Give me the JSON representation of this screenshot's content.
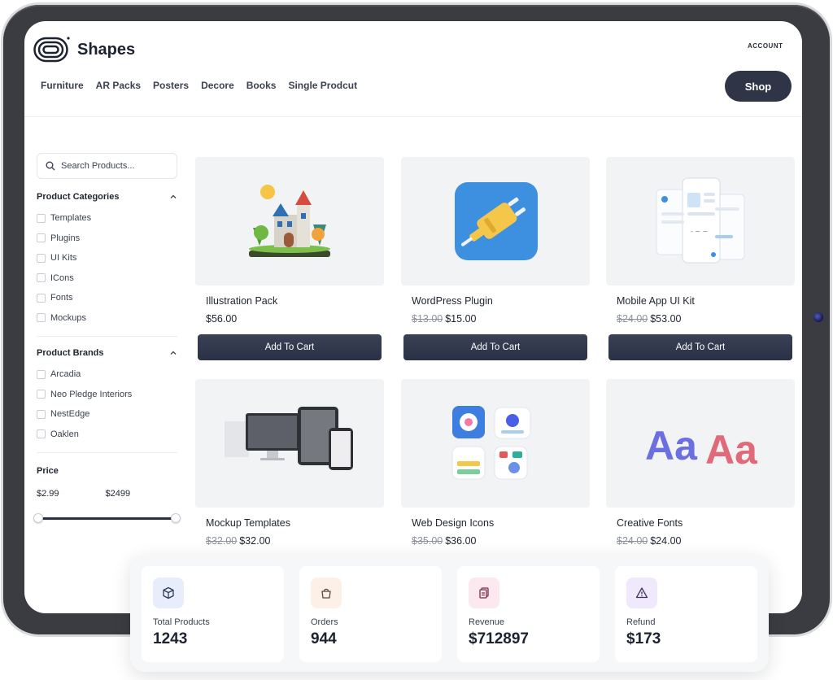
{
  "header": {
    "brand": "Shapes",
    "account_label": "ACCOUNT",
    "nav": [
      "Furniture",
      "AR Packs",
      "Posters",
      "Decore",
      "Books",
      "Single Prodcut"
    ],
    "shop_label": "Shop"
  },
  "sidebar": {
    "search_placeholder": "Search Products...",
    "categories_title": "Product Categories",
    "categories": [
      "Templates",
      "Plugins",
      "UI Kits",
      "ICons",
      "Fonts",
      "Mockups"
    ],
    "brands_title": "Product Brands",
    "brands": [
      "Arcadia",
      "Neo Pledge Interiors",
      "NestEdge",
      "Oaklen"
    ],
    "price_title": "Price",
    "price_min": "$2.99",
    "price_max": "$2499"
  },
  "products": [
    {
      "name": "Illustration Pack",
      "old_price": "",
      "price": "$56.00",
      "icon": "castle-illustration-icon"
    },
    {
      "name": "WordPress Plugin",
      "old_price": "$13.00",
      "price": "$15.00",
      "icon": "plug-icon"
    },
    {
      "name": "Mobile App UI Kit",
      "old_price": "$24.00",
      "price": "$53.00",
      "icon": "mobile-ui-icon"
    },
    {
      "name": "Mockup Templates",
      "old_price": "$32.00",
      "price": "$32.00",
      "icon": "devices-mockup-icon"
    },
    {
      "name": "Web Design Icons",
      "old_price": "$35.00",
      "price": "$36.00",
      "icon": "web-icons-icon"
    },
    {
      "name": "Creative Fonts",
      "old_price": "$24.00",
      "price": "$24.00",
      "icon": "font-aa-icon"
    }
  ],
  "cart_label": "Add To Cart",
  "stats": [
    {
      "label": "Total Products",
      "value": "1243",
      "icon": "box-icon",
      "color": "#e8edfb"
    },
    {
      "label": "Orders",
      "value": "944",
      "icon": "bag-icon",
      "color": "#fdf0e6"
    },
    {
      "label": "Revenue",
      "value": "$712897",
      "icon": "receipt-icon",
      "color": "#fce8ef"
    },
    {
      "label": "Refund",
      "value": "$173",
      "icon": "warning-icon",
      "color": "#efe9fb"
    }
  ]
}
